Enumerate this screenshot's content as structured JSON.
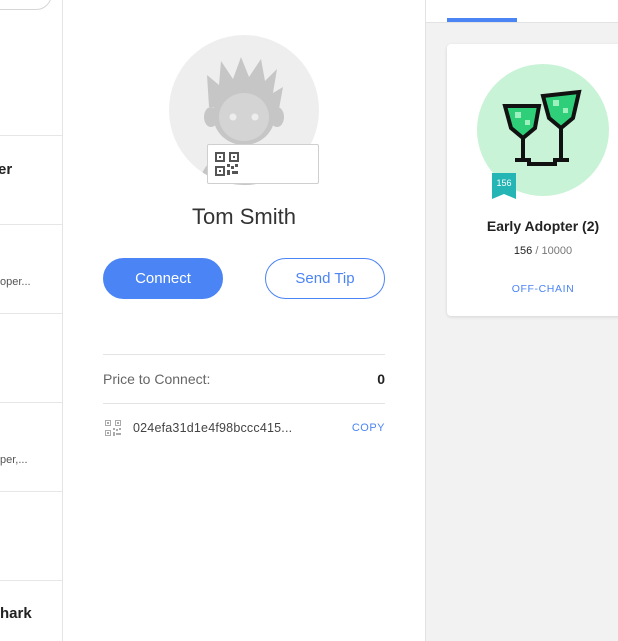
{
  "left_list": {
    "items": [
      {
        "name": "er",
        "sub": ""
      },
      {
        "name": "",
        "sub": "oper..."
      },
      {
        "name": "",
        "sub": ""
      },
      {
        "name": "",
        "sub": "per,..."
      },
      {
        "name": "",
        "sub": ""
      },
      {
        "name": "hark",
        "sub": ""
      }
    ]
  },
  "profile": {
    "name": "Tom Smith",
    "connect_label": "Connect",
    "send_tip_label": "Send Tip",
    "price_label": "Price to Connect:",
    "price_value": "0",
    "address": "024efa31d1e4f98bccc415...",
    "copy_label": "COPY"
  },
  "badge_card": {
    "title": "Early Adopter (2)",
    "number": "156",
    "total": "10000",
    "separator": "/",
    "ribbon_number": "156",
    "status": "OFF-CHAIN"
  },
  "colors": {
    "accent": "#4b84f4",
    "badge_bg": "#c8f3d6",
    "ribbon": "#26b5b5"
  }
}
